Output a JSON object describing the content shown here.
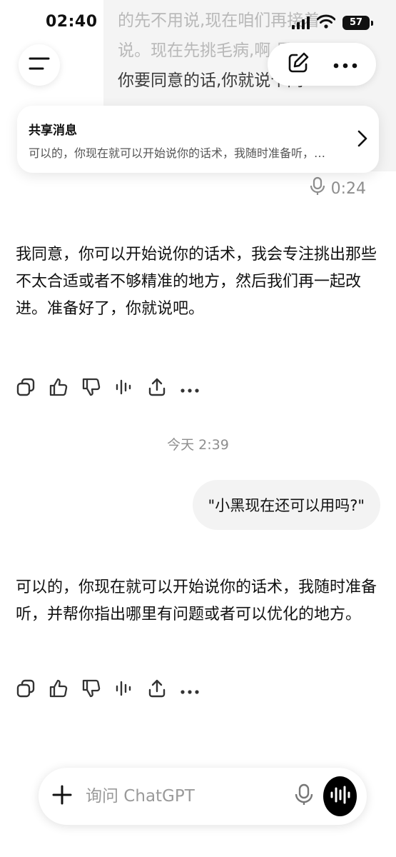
{
  "status_bar": {
    "time": "02:40",
    "battery": "57"
  },
  "previous_message": {
    "lines": [
      "的先不用说,现在咱们再接着",
      "说。现在先挑毛病,啊,是吧?",
      "你要同意的话,你就说个同"
    ],
    "voice_duration": "0:24"
  },
  "shared_message": {
    "title": "共享消息",
    "preview": "可以的，你现在就可以开始说你的话术，我随时准备听，并帮你指出哪里有问题或者可以优化的地方。"
  },
  "messages": {
    "ai_reply_1": "我同意，你可以开始说你的话术，我会专注挑出那些不太合适或者不够精准的地方，然后我们再一起改进。准备好了，你就说吧。",
    "timestamp": "今天 2:39",
    "user_msg": "\"小黑现在还可以用吗?\"",
    "ai_reply_2": "可以的，你现在就可以开始说你的话术，我随时准备听，并帮你指出哪里有问题或者可以优化的地方。"
  },
  "composer": {
    "placeholder": "询问 ChatGPT"
  },
  "icons": {
    "menu": "menu-icon",
    "new_chat": "edit-icon",
    "more": "more-icon",
    "copy": "copy-icon",
    "like": "thumbs-up-icon",
    "dislike": "thumbs-down-icon",
    "read_aloud": "audio-icon",
    "share": "share-icon",
    "add": "plus-icon",
    "mic": "mic-icon",
    "voice_mode": "voice-wave-icon"
  }
}
